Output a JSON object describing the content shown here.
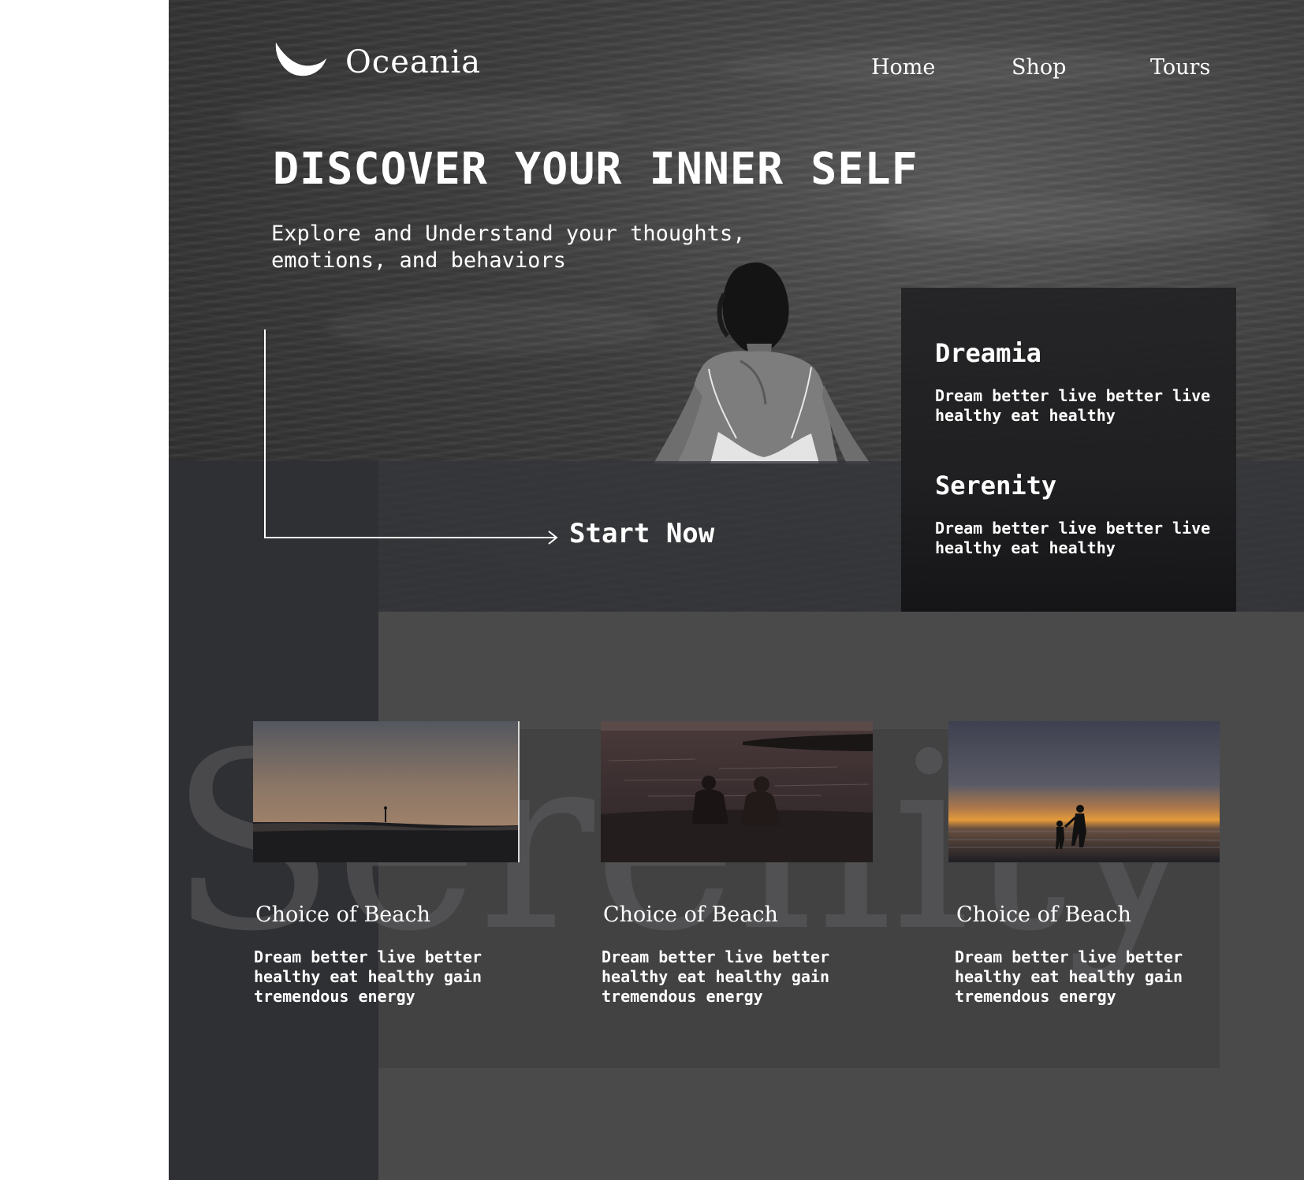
{
  "brand": {
    "name": "Oceania",
    "logo_icon": "crescent-wave-icon"
  },
  "nav": {
    "items": [
      "Home",
      "Shop",
      "Tours"
    ]
  },
  "hero": {
    "title": "DISCOVER YOUR INNER SELF",
    "subtitle": "Explore and Understand your thoughts, emotions, and behaviors",
    "cta": "Start Now"
  },
  "panel": {
    "items": [
      {
        "title": "Dreamia",
        "text": "Dream better live better live healthy eat healthy"
      },
      {
        "title": "Serenity",
        "text": "Dream better live better live healthy eat healthy"
      }
    ]
  },
  "watermark": "Serenity",
  "cards": [
    {
      "title": "Choice of Beach",
      "text": "Dream better live better healthy eat healthy gain tremendous energy"
    },
    {
      "title": "Choice of Beach",
      "text": "Dream better live better healthy eat healthy gain tremendous energy"
    },
    {
      "title": "Choice of Beach",
      "text": "Dream better live better healthy eat healthy gain tremendous energy"
    }
  ],
  "colors": {
    "text": "#ffffff",
    "panel": "#232325",
    "section_dark": "#2f3034",
    "section_grey": "#4a4a4b"
  }
}
